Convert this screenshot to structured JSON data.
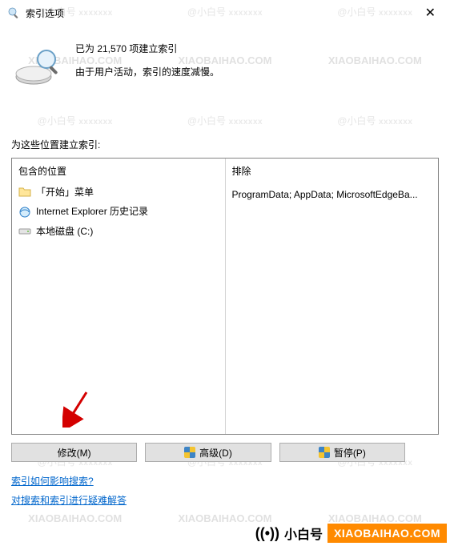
{
  "title": "索引选项",
  "close_glyph": "✕",
  "status_line1": "已为 21,570 项建立索引",
  "status_line2": "由于用户活动，索引的速度减慢。",
  "locations_label": "为这些位置建立索引:",
  "columns": {
    "included": "包含的位置",
    "excluded": "排除"
  },
  "included_items": [
    {
      "icon": "folder-icon",
      "label": "「开始」菜单"
    },
    {
      "icon": "ie-icon",
      "label": "Internet Explorer 历史记录"
    },
    {
      "icon": "drive-icon",
      "label": "本地磁盘 (C:)"
    }
  ],
  "excluded_items": [
    "",
    "",
    "ProgramData; AppData; MicrosoftEdgeBa..."
  ],
  "buttons": {
    "modify": "修改(M)",
    "advanced": "高级(D)",
    "pause": "暂停(P)"
  },
  "links": {
    "how_affects": "索引如何影响搜索?",
    "troubleshoot": "对搜索和索引进行疑难解答"
  },
  "brand": {
    "name": "小白号",
    "domain": "XIAOBAIHAO.COM",
    "tag": "@小白号"
  }
}
